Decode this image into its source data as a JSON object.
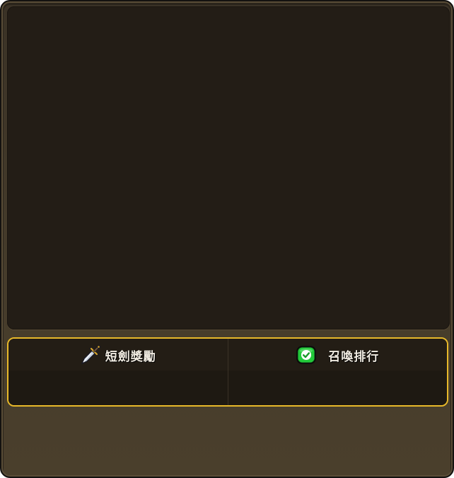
{
  "tabs": [
    {
      "label": "短劍獎勵",
      "icon": "dagger-icon"
    },
    {
      "label": "召喚排行",
      "icon": "green-check-icon"
    }
  ],
  "colors": {
    "frame": "#463c2b",
    "content_panel": "#231d16",
    "tab_border": "#e8b92a",
    "check_green": "#22c93a"
  }
}
